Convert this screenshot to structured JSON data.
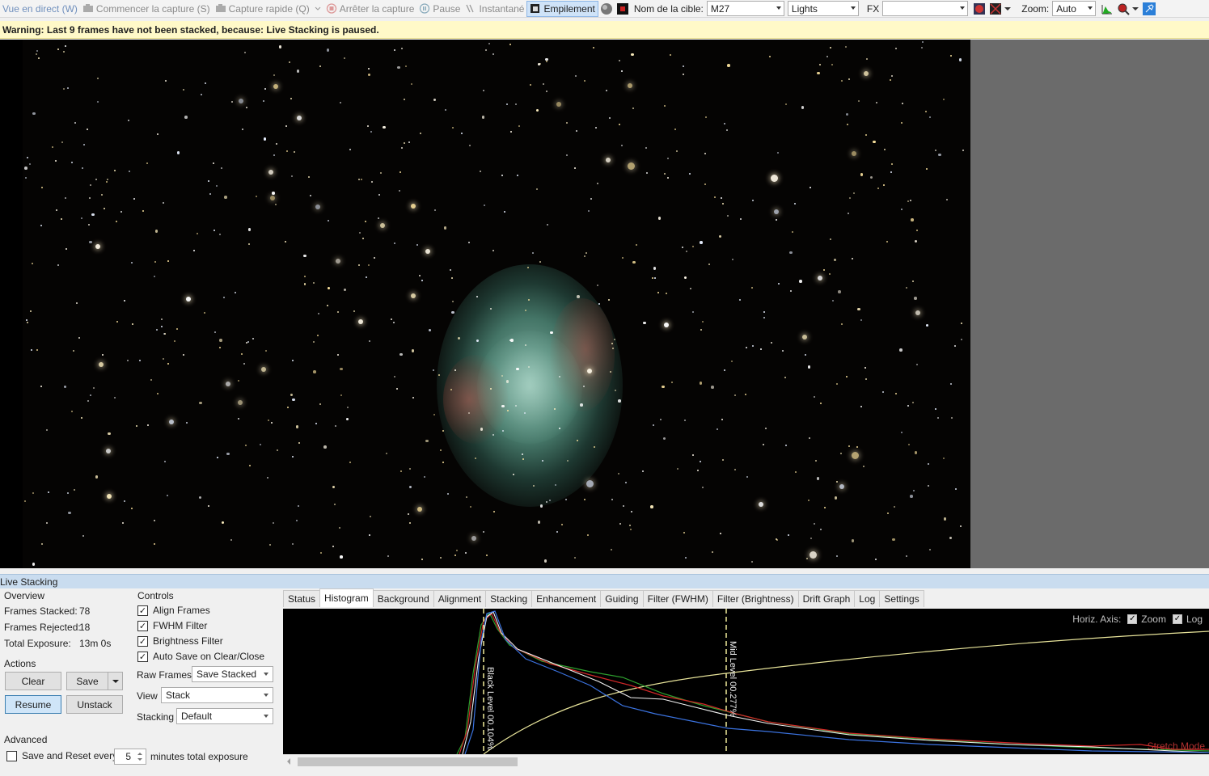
{
  "toolbar": {
    "live_view": "Vue en direct (W)",
    "start_capture": "Commencer la capture (S)",
    "quick_capture": "Capture rapide (Q)",
    "stop_capture": "Arrêter la capture",
    "pause": "Pause",
    "snapshot": "Instantané",
    "stacking": "Empilement",
    "target_name_label": "Nom de la cible:",
    "target_name_value": "M27",
    "frame_type_value": "Lights",
    "fx_label": "FX",
    "fx_value": "",
    "zoom_label": "Zoom:",
    "zoom_value": "Auto"
  },
  "warning": "Warning: Last 9 frames have not been stacked, because: Live Stacking is paused.",
  "live_stacking": {
    "title": "Live Stacking",
    "overview": {
      "title": "Overview",
      "frames_stacked_label": "Frames Stacked:",
      "frames_stacked_value": "78",
      "frames_rejected_label": "Frames Rejected:",
      "frames_rejected_value": "18",
      "total_exposure_label": "Total Exposure:",
      "total_exposure_value": "13m 0s"
    },
    "actions": {
      "title": "Actions",
      "clear": "Clear",
      "save": "Save",
      "resume": "Resume",
      "unstack": "Unstack"
    },
    "advanced": {
      "title": "Advanced",
      "save_reset_label": "Save and Reset every",
      "save_reset_value": "5",
      "save_reset_suffix": "minutes total exposure"
    },
    "controls": {
      "title": "Controls",
      "align_frames": "Align Frames",
      "fwhm_filter": "FWHM Filter",
      "brightness_filter": "Brightness Filter",
      "auto_save": "Auto Save on Clear/Close",
      "raw_frames_label": "Raw Frames",
      "raw_frames_value": "Save Stacked",
      "view_label": "View",
      "view_value": "Stack",
      "stacking_label": "Stacking",
      "stacking_value": "Default"
    },
    "tabs": [
      "Status",
      "Histogram",
      "Background",
      "Alignment",
      "Stacking",
      "Enhancement",
      "Guiding",
      "Filter (FWHM)",
      "Filter (Brightness)",
      "Drift Graph",
      "Log",
      "Settings"
    ],
    "histogram": {
      "horiz_axis_label": "Horiz. Axis:",
      "zoom_label": "Zoom",
      "log_label": "Log",
      "black_level": "Black Level  00.104%",
      "mid_level": "Mid Level  00.277%",
      "stretch_mode": "Stretch Mode"
    }
  },
  "colors": {
    "accent": "#3c7fb1",
    "warning_bg": "#fff9c8",
    "panel_title_bg": "#c9dcef"
  }
}
